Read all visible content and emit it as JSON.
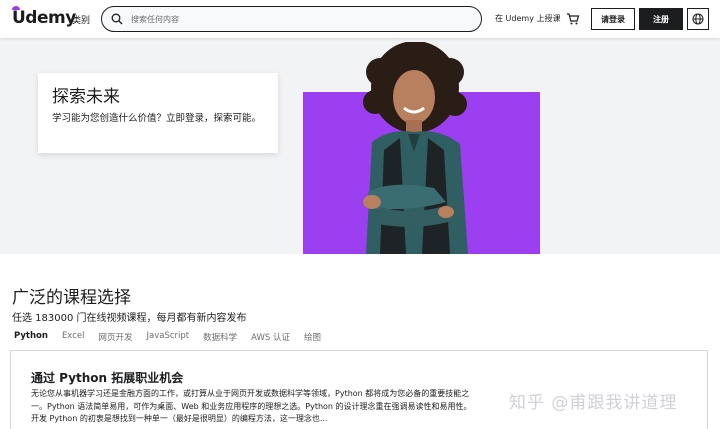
{
  "header": {
    "logo": "Udemy",
    "categories_label": "类别",
    "search_placeholder": "搜索任何内容",
    "teach_label": "在 Udemy 上授课",
    "login_label": "请登录",
    "signup_label": "注册"
  },
  "hero": {
    "title": "探索未来",
    "subtitle": "学习能为您创造什么价值？立即登录，探索可能。"
  },
  "courses": {
    "title": "广泛的课程选择",
    "subtitle": "任选 183000 门在线视频课程，每月都有新内容发布",
    "tabs": [
      "Python",
      "Excel",
      "网页开发",
      "JavaScript",
      "数据科学",
      "AWS 认证",
      "绘图"
    ],
    "active_tab_index": 0,
    "panel_title": "通过 Python 拓展职业机会",
    "panel_text": "无论您从事机器学习还是金融方面的工作，或打算从业于网页开发或数据科学等领域，Python 都将成为您必备的重要技能之一。Python 语法简单易用，可作为桌面、Web 和业务应用程序的理想之选。Python 的设计理念重在强调易读性和易用性。开发 Python 的初衷是想找到一种单一（最好是很明显）的编程方法，这一理念也..."
  },
  "watermark": "知乎 @甫跟我讲道理",
  "colors": {
    "brand_purple": "#a435f0",
    "hero_purple": "#9b3ff0",
    "text_dark": "#1c1d1f"
  }
}
